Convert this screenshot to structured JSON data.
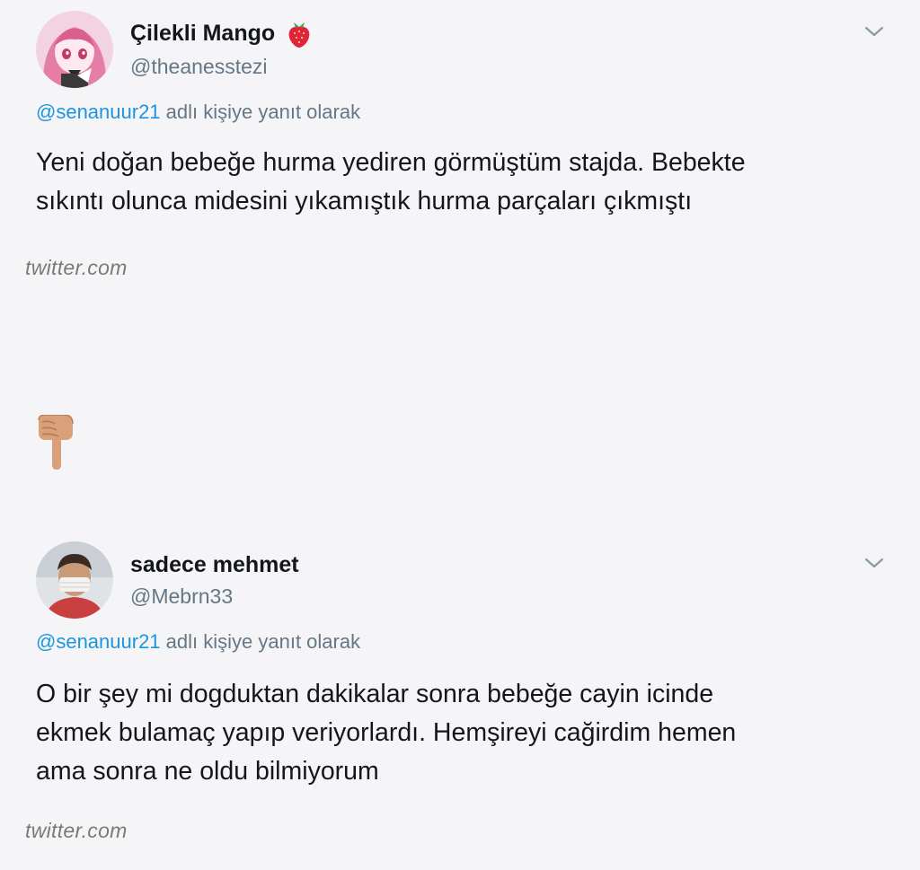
{
  "tweets": [
    {
      "display_name": "Çilekli Mango",
      "name_emoji": "strawberry-emoji",
      "handle": "@theanesstezi",
      "reply_mention": "@senanuur21",
      "reply_suffix": " adlı kişiye yanıt olarak",
      "body_lines": [
        "Yeni doğan bebeğe hurma yediren görmüştüm stajda. Bebekte",
        "sıkıntı olunca midesini yıkamıştık hurma parçaları çıkmıştı"
      ],
      "source": "twitter.com",
      "menu_icon": "chevron-down-icon"
    },
    {
      "display_name": "sadece mehmet",
      "handle": "@Mebrn33",
      "reply_mention": "@senanuur21",
      "reply_suffix": " adlı kişiye yanıt olarak",
      "body_lines": [
        "O bir şey mi dogduktan dakikalar sonra bebeğe cayin icinde",
        "ekmek bulamaç yapıp veriyorlardı. Hemşireyi cağirdim hemen",
        "ama sonra ne oldu bilmiyorum"
      ],
      "source": "twitter.com",
      "menu_icon": "chevron-down-icon"
    }
  ],
  "separator_icon": "pointing-down-hand-emoji",
  "colors": {
    "background": "#f5f5f7",
    "text": "#14171a",
    "secondary": "#657786",
    "link": "#1b95e0",
    "watermark": "#7a7a7a",
    "strawberry": "#e0243a"
  }
}
